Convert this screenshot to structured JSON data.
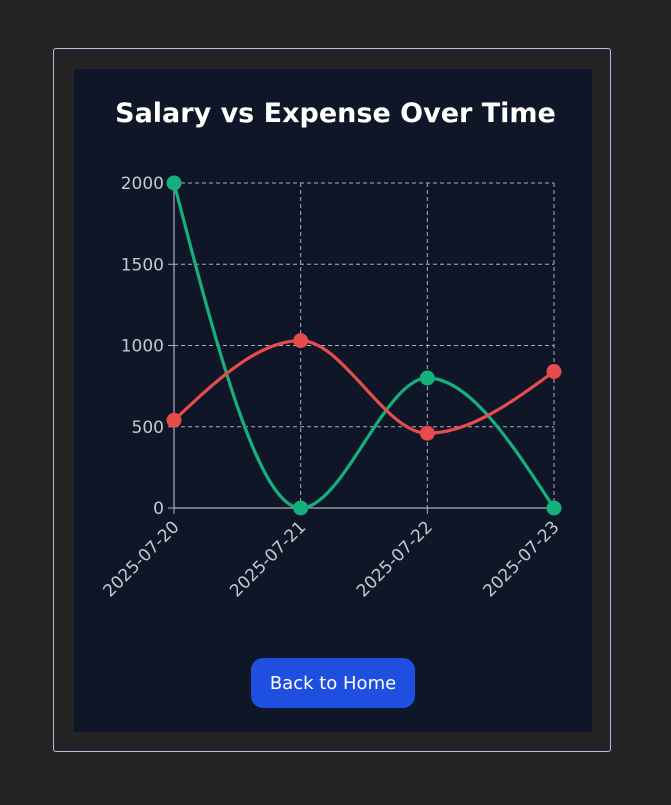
{
  "page": {
    "back_button_label": "Back to Home"
  },
  "colors": {
    "background": "#242424",
    "panel": "#0e1628",
    "salary": "#16b07d",
    "expense": "#e74c4c",
    "grid": "#aab0bb",
    "button": "#1e4fe0"
  },
  "chart_data": {
    "type": "line",
    "title": "Salary vs Expense Over Time",
    "categories": [
      "2025-07-20",
      "2025-07-21",
      "2025-07-22",
      "2025-07-23"
    ],
    "series": [
      {
        "key": "salary",
        "values": [
          2000,
          0,
          800,
          0
        ]
      },
      {
        "key": "expense",
        "values": [
          540,
          1030,
          460,
          840
        ]
      }
    ],
    "ylim": [
      0,
      2000
    ],
    "yticks": [
      0,
      500,
      1000,
      1500,
      2000
    ],
    "grid": true,
    "curve": "smooth"
  }
}
